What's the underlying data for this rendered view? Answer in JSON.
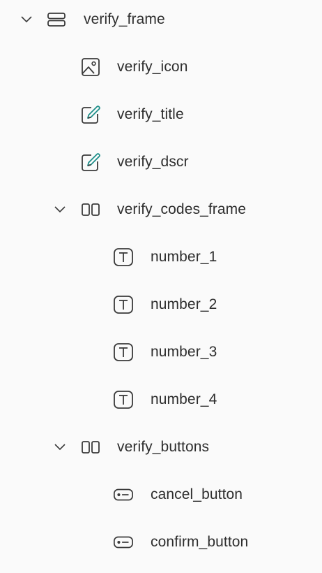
{
  "tree": {
    "verify_frame": "verify_frame",
    "verify_icon": "verify_icon",
    "verify_title": "verify_title",
    "verify_dscr": "verify_dscr",
    "verify_codes_frame": "verify_codes_frame",
    "number_1": "number_1",
    "number_2": "number_2",
    "number_3": "number_3",
    "number_4": "number_4",
    "verify_buttons": "verify_buttons",
    "cancel_button": "cancel_button",
    "confirm_button": "confirm_button"
  },
  "icons": {
    "verify_frame": "vertical-stack-icon",
    "verify_icon": "image-icon",
    "verify_title": "edit-text-icon",
    "verify_dscr": "edit-text-icon",
    "verify_codes_frame": "horizontal-columns-icon",
    "number": "text-icon",
    "verify_buttons": "horizontal-columns-icon",
    "button": "button-icon"
  },
  "colors": {
    "text": "#2e2e2e",
    "icon": "#3a3a3a",
    "pencil_accent": "#1f8f8a",
    "background": "#fafafa"
  }
}
